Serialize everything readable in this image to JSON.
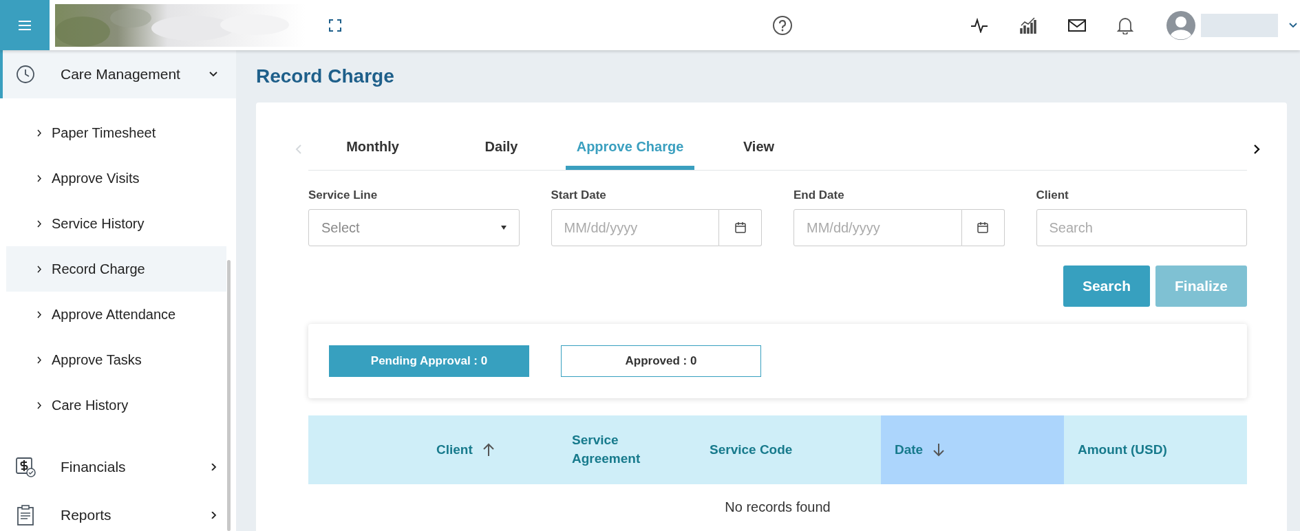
{
  "topbar": {
    "icons": [
      {
        "kind": "pulse"
      },
      {
        "kind": "chart"
      },
      {
        "kind": "mail"
      },
      {
        "kind": "bell"
      }
    ]
  },
  "sidebar": {
    "items": [
      {
        "label": "Care Management",
        "kind": "clock",
        "expanded": true,
        "selected": true,
        "children": [
          {
            "label": "Paper Timesheet",
            "selected": false
          },
          {
            "label": "Approve Visits",
            "selected": false
          },
          {
            "label": "Service History",
            "selected": false
          },
          {
            "label": "Record Charge",
            "selected": true
          },
          {
            "label": "Approve Attendance",
            "selected": false
          },
          {
            "label": "Approve Tasks",
            "selected": false
          },
          {
            "label": "Care History",
            "selected": false
          }
        ]
      },
      {
        "label": "Financials",
        "kind": "dollar",
        "expanded": false,
        "selected": false
      },
      {
        "label": "Reports",
        "kind": "clipboard",
        "expanded": false,
        "selected": false
      }
    ]
  },
  "page": {
    "title": "Record Charge"
  },
  "tabs": {
    "prev_disabled": true,
    "next_disabled": false,
    "items": [
      {
        "label": "Monthly",
        "selected": false
      },
      {
        "label": "Daily",
        "selected": false
      },
      {
        "label": "Approve Charge",
        "selected": true
      },
      {
        "label": "View",
        "selected": false
      }
    ]
  },
  "filters": [
    {
      "label": "Service Line",
      "kind": "select",
      "placeholder": "Select"
    },
    {
      "label": "Start Date",
      "kind": "date",
      "placeholder": "MM/dd/yyyy"
    },
    {
      "label": "End Date",
      "kind": "date",
      "placeholder": "MM/dd/yyyy"
    },
    {
      "label": "Client",
      "kind": "text",
      "placeholder": "Search"
    }
  ],
  "buttons": [
    {
      "label": "Search",
      "disabled": false
    },
    {
      "label": "Finalize",
      "disabled": true
    }
  ],
  "status_tabs": [
    {
      "label": "Pending Approval : 0",
      "selected": true
    },
    {
      "label": "Approved : 0",
      "selected": false
    }
  ],
  "table": {
    "columns": [
      {
        "label": "Client",
        "sort_up": true,
        "sort_down": false,
        "active": false
      },
      {
        "label": "Service Agreement",
        "sort_up": false,
        "sort_down": false,
        "active": false
      },
      {
        "label": "Service Code",
        "sort_up": false,
        "sort_down": false,
        "active": false
      },
      {
        "label": "Date",
        "sort_up": false,
        "sort_down": true,
        "active": true
      },
      {
        "label": "Amount (USD)",
        "sort_up": false,
        "sort_down": false,
        "active": false
      }
    ],
    "empty_text": "No records found"
  }
}
